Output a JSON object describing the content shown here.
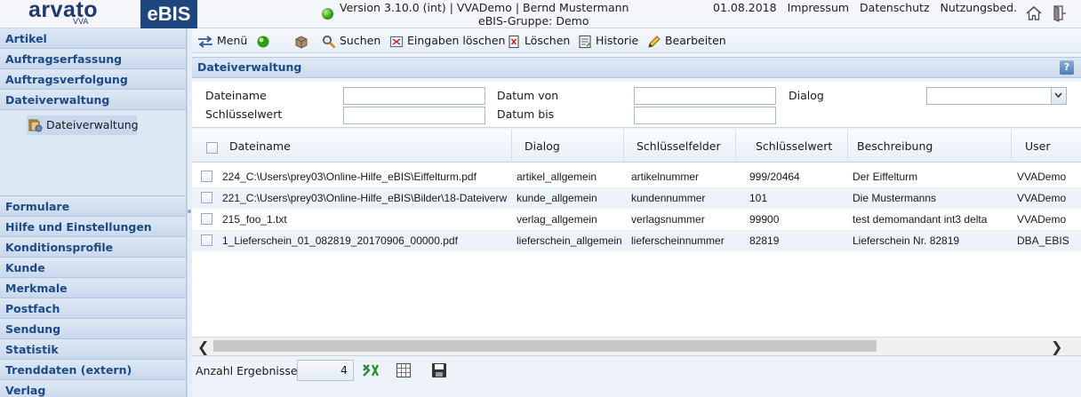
{
  "header": {
    "logo": "arvato",
    "logo_sub": "VVA",
    "product": "eBIS",
    "version_line1": "Version 3.10.0 (int) | VVADemo | Bernd Mustermann",
    "version_line2": "eBIS-Gruppe: Demo",
    "date": "01.08.2018",
    "links": [
      "Impressum",
      "Datenschutz",
      "Nutzungsbed."
    ]
  },
  "sidebar": {
    "top_items": [
      "Artikel",
      "Auftragserfassung",
      "Auftragsverfolgung",
      "Dateiverwaltung"
    ],
    "active_sub": "Dateiverwaltung",
    "bottom_items": [
      "Formulare",
      "Hilfe und Einstellungen",
      "Konditionsprofile",
      "Kunde",
      "Merkmale",
      "Postfach",
      "Sendung",
      "Statistik",
      "Trenddaten (extern)",
      "Verlag"
    ]
  },
  "toolbar": {
    "menu": "Menü",
    "suchen": "Suchen",
    "eingaben_loeschen": "Eingaben löschen",
    "loeschen": "Löschen",
    "historie": "Historie",
    "bearbeiten": "Bearbeiten"
  },
  "panel": {
    "title": "Dateiverwaltung",
    "help": "?"
  },
  "search": {
    "dateiname_label": "Dateiname",
    "dateiname_value": "",
    "schluesselwert_label": "Schlüsselwert",
    "schluesselwert_value": "",
    "datum_von_label": "Datum von",
    "datum_von_value": "",
    "datum_bis_label": "Datum bis",
    "datum_bis_value": "",
    "dialog_label": "Dialog",
    "dialog_value": ""
  },
  "grid": {
    "columns": [
      "Dateiname",
      "Dialog",
      "Schlüsselfelder",
      "Schlüsselwert",
      "Beschreibung",
      "User"
    ],
    "rows": [
      [
        "224_C:\\Users\\prey03\\Online-Hilfe_eBIS\\Eiffelturm.pdf",
        "artikel_allgemein",
        "artikelnummer",
        "999/20464",
        "Der Eiffelturm",
        "VVADemo"
      ],
      [
        "221_C:\\Users\\prey03\\Online-Hilfe_eBIS\\Bilder\\18-Dateiverw",
        "kunde_allgemein",
        "kundennummer",
        "101",
        "Die Mustermanns",
        "VVADemo"
      ],
      [
        "215_foo_1.txt",
        "verlag_allgemein",
        "verlagsnummer",
        "99900",
        "test demomandant int3 delta",
        "VVADemo"
      ],
      [
        "1_Lieferschein_01_082819_20170906_00000.pdf",
        "lieferschein_allgemein",
        "lieferscheinnummer",
        "82819",
        "Lieferschein Nr. 82819",
        "DBA_EBIS"
      ]
    ]
  },
  "footer": {
    "count_label": "Anzahl Ergebnisse:",
    "count": "4"
  },
  "icons": {
    "menu": "menu-arrows-icon",
    "status": "green-status-icon",
    "export_excel": "excel-icon",
    "grid_view": "grid-icon",
    "save": "save-icon",
    "home": "home-icon",
    "exit": "exit-icon"
  }
}
